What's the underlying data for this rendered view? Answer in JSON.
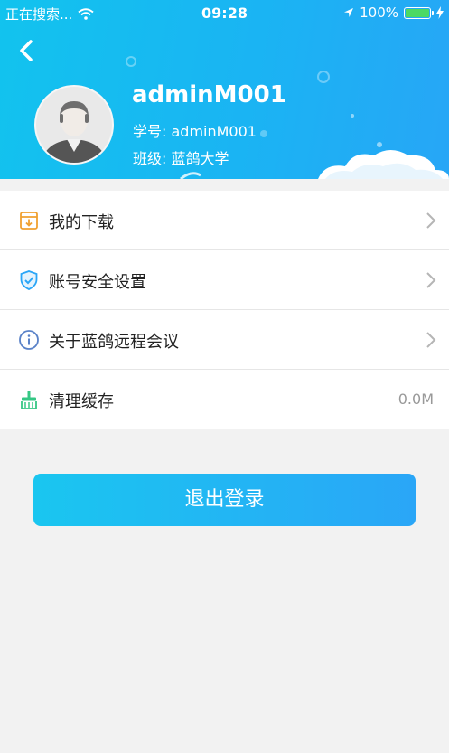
{
  "status_bar": {
    "carrier": "正在搜索...",
    "time": "09:28",
    "battery": "100%"
  },
  "profile": {
    "username": "adminM001",
    "student_id": "学号: adminM001",
    "class": "班级: 蓝鸽大学"
  },
  "menu": {
    "items": [
      {
        "label": "我的下载",
        "icon": "download-box-icon"
      },
      {
        "label": "账号安全设置",
        "icon": "shield-check-icon"
      },
      {
        "label": "关于蓝鸽远程会议",
        "icon": "info-icon"
      },
      {
        "label": "清理缓存",
        "icon": "broom-icon",
        "value": "0.0M"
      }
    ]
  },
  "logout_label": "退出登录",
  "colors": {
    "header": "#1ab4f3",
    "button": "#22b6f4",
    "download_icon": "#f0a030",
    "shield_icon": "#2aa6f7",
    "info_icon": "#5a82c8",
    "broom_icon": "#35c784"
  }
}
